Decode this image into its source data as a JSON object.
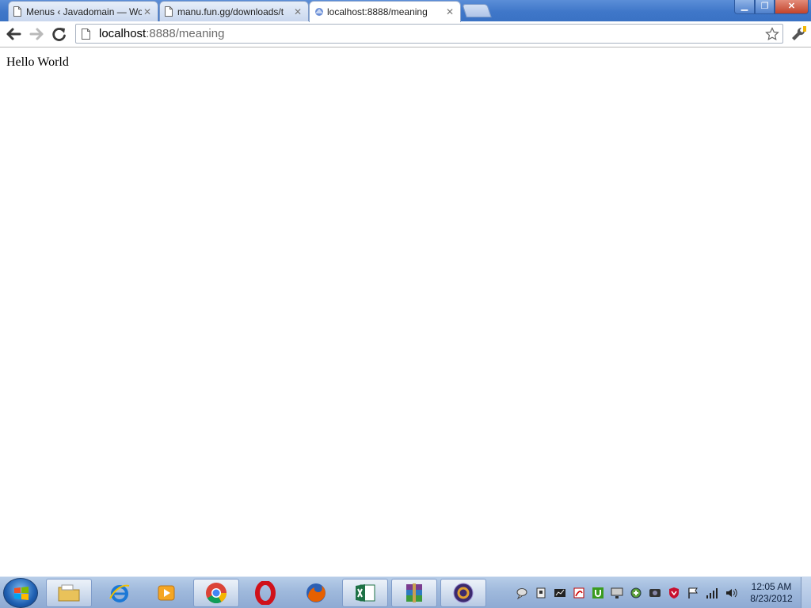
{
  "window": {
    "buttons": {
      "minimize": "▁",
      "maximize": "❐",
      "close": "✕"
    }
  },
  "tabs": [
    {
      "title": "Menus ‹ Javadomain — Wo",
      "close": "✕",
      "active": false
    },
    {
      "title": "manu.fun.gg/downloads/t",
      "close": "✕",
      "active": false
    },
    {
      "title": "localhost:8888/meaning",
      "close": "✕",
      "active": true
    }
  ],
  "toolbar": {
    "url_host": "localhost",
    "url_rest": ":8888/meaning"
  },
  "page": {
    "text": "Hello World"
  },
  "taskbar": {
    "apps": [
      {
        "name": "windows-explorer",
        "icon": "folder-icon"
      },
      {
        "name": "internet-explorer",
        "icon": "ie-icon"
      },
      {
        "name": "media-player",
        "icon": "media-player-icon"
      },
      {
        "name": "chrome",
        "icon": "chrome-icon"
      },
      {
        "name": "opera",
        "icon": "opera-icon"
      },
      {
        "name": "firefox",
        "icon": "firefox-icon"
      },
      {
        "name": "excel",
        "icon": "excel-icon"
      },
      {
        "name": "winrar",
        "icon": "winrar-icon"
      },
      {
        "name": "java-ee-ide",
        "icon": "java-ee-ide-icon"
      }
    ],
    "clock": {
      "time": "12:05 AM",
      "date": "8/23/2012"
    }
  },
  "colors": {
    "titlebar": "#3f77c9",
    "taskbar": "#9fb9dc",
    "url_rest": "#6b6b6b"
  }
}
